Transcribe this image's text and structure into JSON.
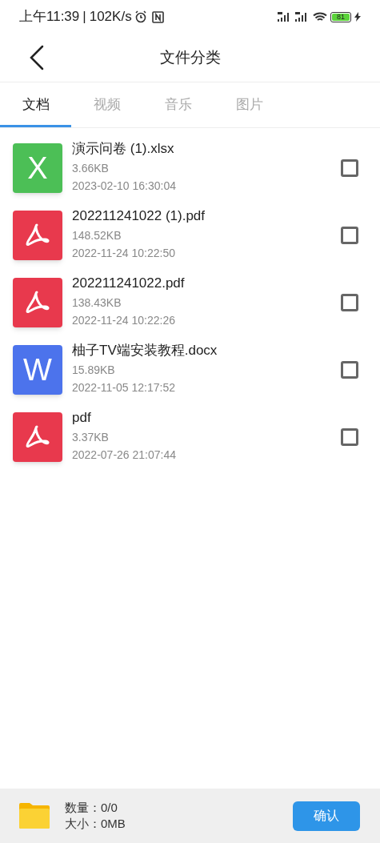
{
  "status_bar": {
    "time": "上午11:39",
    "separator": "|",
    "speed": "102K/s",
    "battery": "81"
  },
  "header": {
    "title": "文件分类"
  },
  "tabs": [
    {
      "label": "文档",
      "selected": true
    },
    {
      "label": "视频",
      "selected": false
    },
    {
      "label": "音乐",
      "selected": false
    },
    {
      "label": "图片",
      "selected": false
    }
  ],
  "files": [
    {
      "kind": "xlsx",
      "letter": "X",
      "name": "演示问卷 (1).xlsx",
      "size": "3.66KB",
      "date": "2023-02-10 16:30:04",
      "checked": false
    },
    {
      "kind": "pdf",
      "name": "202211241022 (1).pdf",
      "size": "148.52KB",
      "date": "2022-11-24 10:22:50",
      "checked": false
    },
    {
      "kind": "pdf",
      "name": "202211241022.pdf",
      "size": "138.43KB",
      "date": "2022-11-24 10:22:26",
      "checked": false
    },
    {
      "kind": "docx",
      "letter": "W",
      "name": "柚子TV端安装教程.docx",
      "size": "15.89KB",
      "date": "2022-11-05 12:17:52",
      "checked": false
    },
    {
      "kind": "pdf",
      "name": "pdf",
      "size": "3.37KB",
      "date": "2022-07-26 21:07:44",
      "checked": false
    }
  ],
  "footer": {
    "count": "数量：0/0",
    "size": "大小：0MB",
    "confirm": "确认"
  }
}
